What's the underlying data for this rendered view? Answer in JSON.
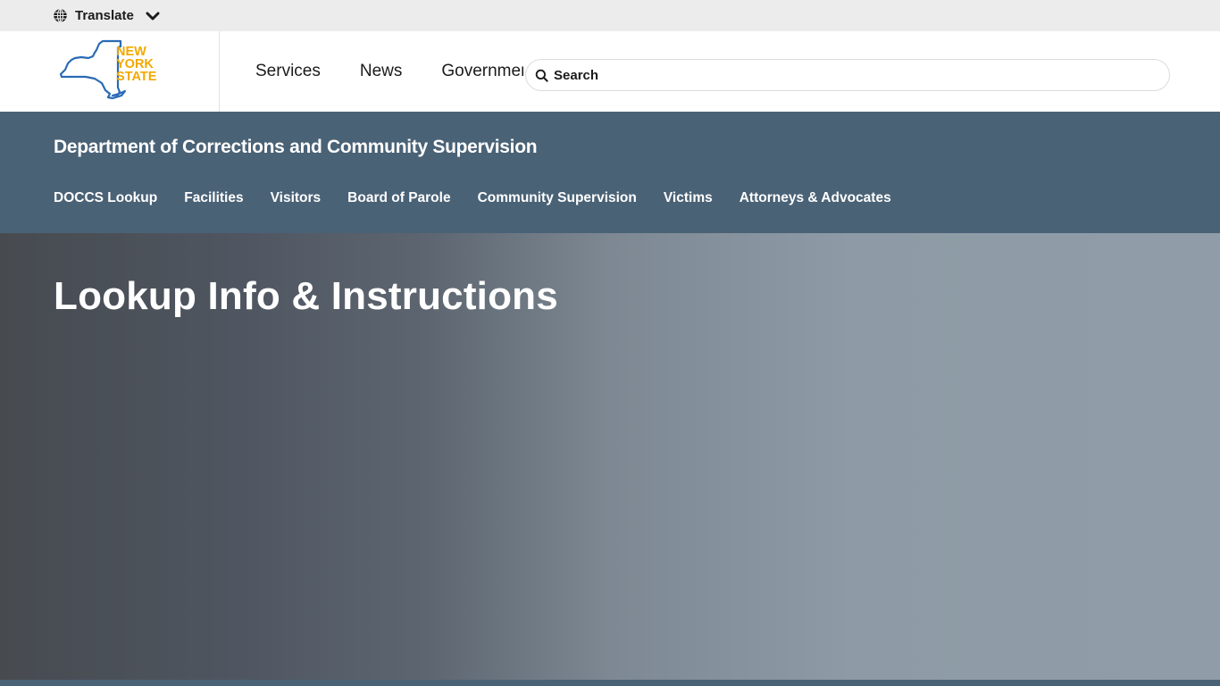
{
  "topbar": {
    "translate_label": "Translate",
    "globe_icon": "globe-icon",
    "chevron_icon": "chevron-down-icon"
  },
  "header": {
    "logo": {
      "line1": "NEW",
      "line2": "YORK",
      "line3": "STATE",
      "outline_color": "#2a6bb5",
      "text_color": "#f2a900"
    },
    "nav": [
      {
        "label": "Services"
      },
      {
        "label": "News"
      },
      {
        "label": "Government"
      }
    ],
    "search": {
      "placeholder": "Search",
      "value": "",
      "icon": "search-icon"
    }
  },
  "agency": {
    "name": "Department of Corrections and Community Supervision",
    "subnav": [
      {
        "label": "DOCCS Lookup"
      },
      {
        "label": "Facilities"
      },
      {
        "label": "Visitors"
      },
      {
        "label": "Board of Parole"
      },
      {
        "label": "Community Supervision"
      },
      {
        "label": "Victims"
      },
      {
        "label": "Attorneys & Advocates"
      }
    ],
    "background_color": "#4a6276"
  },
  "hero": {
    "title": "Lookup Info & Instructions"
  }
}
